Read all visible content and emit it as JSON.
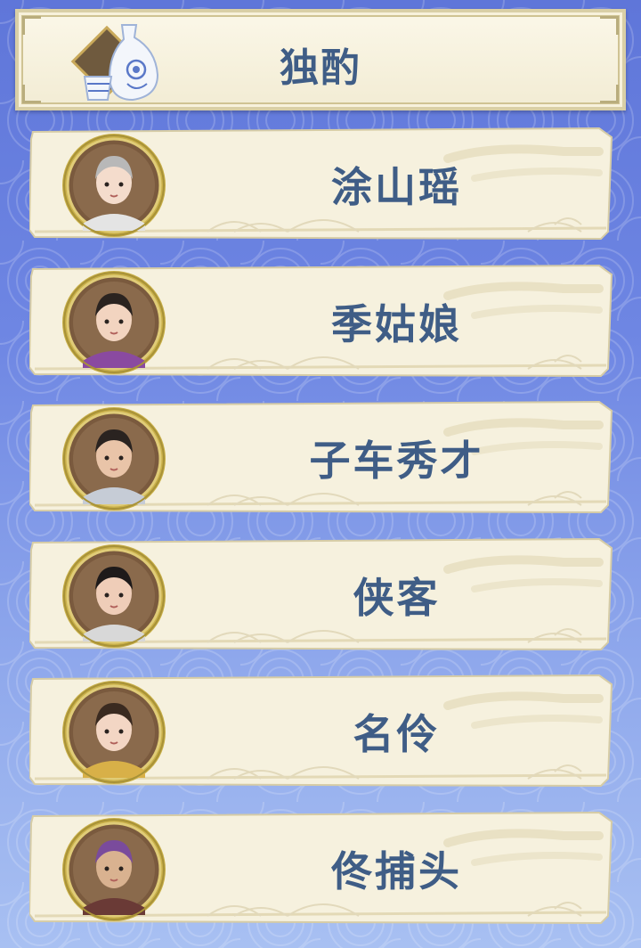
{
  "header": {
    "title": "独酌",
    "icon": "wine-bottle-and-cup-icon"
  },
  "characters": [
    {
      "name": "涂山瑶",
      "avatar": "fox-spirit-girl-portrait",
      "skin": "#f4dccc",
      "hair": "#b8b8b8",
      "outfit": "#e4e4e4"
    },
    {
      "name": "季姑娘",
      "avatar": "young-lady-portrait",
      "skin": "#f2d4c0",
      "hair": "#2a2320",
      "outfit": "#8a4aa0"
    },
    {
      "name": "子车秀才",
      "avatar": "scholar-portrait",
      "skin": "#e9c4a8",
      "hair": "#2a2320",
      "outfit": "#c6ccd6"
    },
    {
      "name": "侠客",
      "avatar": "swordsman-with-hat-portrait",
      "skin": "#efcdb8",
      "hair": "#1e1a1a",
      "outfit": "#d8d8d8"
    },
    {
      "name": "名伶",
      "avatar": "opera-singer-portrait",
      "skin": "#f3d6c4",
      "hair": "#3a2a20",
      "outfit": "#d8b048"
    },
    {
      "name": "佟捕头",
      "avatar": "constable-portrait",
      "skin": "#d9b290",
      "hair": "#7a4b9c",
      "outfit": "#6a3a36"
    }
  ],
  "colors": {
    "label_text": "#3f5d86",
    "scroll_paper": "#f6f1de",
    "frame_gold": "#c9b04a",
    "background": "#6e86e3"
  }
}
